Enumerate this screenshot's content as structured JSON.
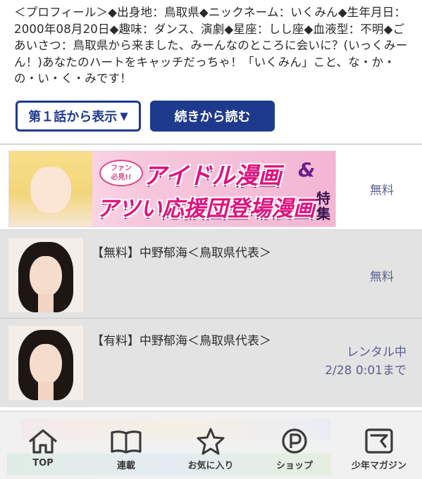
{
  "profile": {
    "text": "＜プロフィール＞◆出身地：鳥取県◆ニックネーム：いくみん◆生年月日：2000年08月20日◆趣味：ダンス、演劇◆星座：しし座◆血液型：不明◆ごあいさつ：鳥取県から来ました、みーんなのところに会いに？(いっくみーん！)あなたのハートをキャッチだっちゃ！「いくみん」こと、な・か・の・い・く・みです！"
  },
  "buttons": {
    "from_first": "第１話から表示",
    "from_first_icon": "▼",
    "continue": "続きから読む"
  },
  "banner": {
    "badge_line1": "ファン",
    "badge_line2": "必見!!",
    "line1": "アイドル漫画",
    "amp": "&",
    "line2": "アツい応援団登場漫画",
    "tokushu": "特集",
    "price": "無料"
  },
  "items": [
    {
      "title": "【無料】中野郁海＜鳥取県代表＞",
      "price": "無料"
    },
    {
      "title": "【有料】中野郁海＜鳥取県代表＞",
      "status": "レンタル中",
      "until": "2/28 0:01まで"
    }
  ],
  "tabbar": {
    "tabs": [
      {
        "label": "TOP",
        "icon": "home-icon"
      },
      {
        "label": "連載",
        "icon": "book-icon"
      },
      {
        "label": "お気に入り",
        "icon": "star-icon"
      },
      {
        "label": "ショップ",
        "icon": "shop-p-icon"
      },
      {
        "label": "少年マガジン",
        "icon": "magazine-m-icon"
      }
    ]
  },
  "colors": {
    "accent": "#1e3a8c",
    "price_text": "#5a5f8e",
    "row_gray": "#e3e3e3"
  }
}
